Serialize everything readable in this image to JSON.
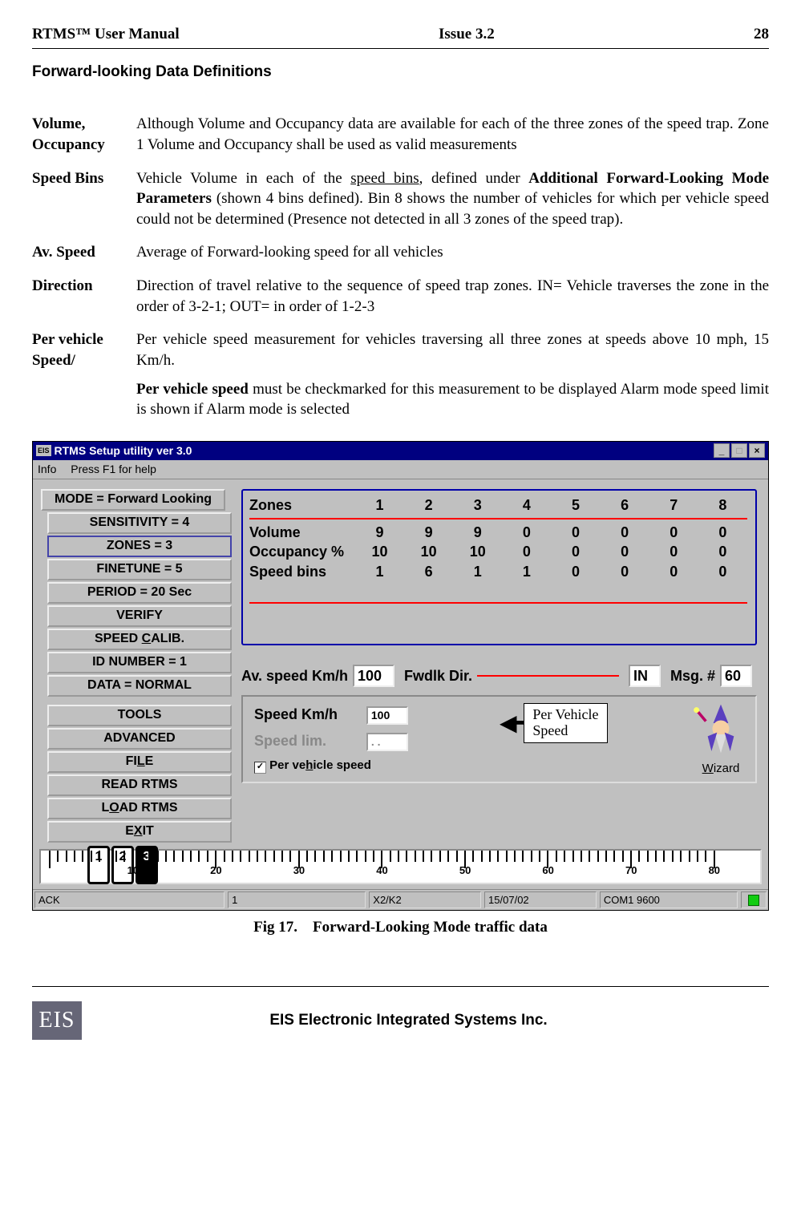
{
  "header": {
    "left": "RTMS™ User Manual",
    "center": "Issue 3.2",
    "right": "28"
  },
  "section_title": "Forward-looking Data Definitions",
  "defs": {
    "volume": {
      "term": "Volume, Occupancy",
      "body_plain": "Although Volume and Occupancy data are available for each of the three zones of the speed trap.  Zone 1 Volume and Occupancy shall be used as valid measurements"
    },
    "speedbins": {
      "term": "Speed Bins",
      "pre": "Vehicle Volume in each of the ",
      "ul": "speed bins",
      "mid": ", defined under ",
      "bold": "Additional Forward-Looking Mode Parameters",
      "post": " (shown 4 bins defined).  Bin 8 shows the number of vehicles for which per vehicle speed could not be determined (Presence not detected in all 3 zones of the speed trap)."
    },
    "avspeed": {
      "term": "Av. Speed",
      "body": "Average of Forward-looking speed for all vehicles"
    },
    "direction": {
      "term": "Direction",
      "body": "Direction of travel  relative to the sequence of speed trap zones. IN= Vehicle traverses the zone in the order of 3-2-1; OUT= in order of 1-2-3"
    },
    "perveh": {
      "term": "Per vehicle Speed/",
      "body1": "Per vehicle speed measurement for vehicles traversing all three zones at speeds above 10 mph, 15 Km/h.",
      "bold": "Per vehicle speed",
      "body2": " must be checkmarked for this measurement to be displayed Alarm mode speed limit is shown if Alarm mode is selected"
    }
  },
  "shot": {
    "title_icon": "EIS",
    "title": "RTMS Setup utility ver 3.0",
    "menu1": "Info",
    "menu2": "Press F1 for help",
    "left_buttons": {
      "b1": "MODE = Forward Looking",
      "b2": "SENSITIVITY = 4",
      "b3": "ZONES = 3",
      "b4": "FINETUNE = 5",
      "b5": "PERIOD = 20 Sec",
      "b6": "VERIFY",
      "b7": "SPEED CALIB.",
      "b8": "ID NUMBER = 1",
      "b9": "DATA = NORMAL",
      "b10": "TOOLS",
      "b11": "ADVANCED",
      "b12": "FILE",
      "b13": "READ RTMS",
      "b14": "LOAD RTMS",
      "b15": "EXIT"
    },
    "table": {
      "r0": "Zones",
      "r1": "Volume",
      "r2": "Occupancy %",
      "r3": "Speed bins",
      "cols": [
        "1",
        "2",
        "3",
        "4",
        "5",
        "6",
        "7",
        "8"
      ],
      "volume": [
        "9",
        "9",
        "9",
        "0",
        "0",
        "0",
        "0",
        "0"
      ],
      "occupancy": [
        "10",
        "10",
        "10",
        "0",
        "0",
        "0",
        "0",
        "0"
      ],
      "speedbins": [
        "1",
        "6",
        "1",
        "1",
        "0",
        "0",
        "0",
        "0"
      ]
    },
    "mid": {
      "avspeed_lbl": "Av. speed Km/h",
      "avspeed_val": "100",
      "dir_lbl": "Fwdlk Dir.",
      "dir_val": "IN",
      "msg_lbl": "Msg. #",
      "msg_val": "60"
    },
    "panel": {
      "speed_lbl": "Speed Km/h",
      "speed_val": "100",
      "lim_lbl": "Speed lim.",
      "lim_val": ". .",
      "check_lbl": "Per vehicle speed",
      "callout_l1": "Per Vehicle",
      "callout_l2": "Speed",
      "wizard": "Wizard"
    },
    "ruler_ticks": [
      "10",
      "20",
      "30",
      "40",
      "50",
      "60",
      "70",
      "80"
    ],
    "lanes": [
      "1",
      "2",
      "3"
    ],
    "status": {
      "s1": "ACK",
      "s2": "1",
      "s3": "X2/K2",
      "s4": "15/07/02",
      "s5": "COM1 9600"
    }
  },
  "caption": {
    "num": "Fig 17.",
    "text": "Forward-Looking Mode traffic data"
  },
  "footer": {
    "logo": "EIS",
    "text": "EIS Electronic Integrated Systems Inc."
  }
}
